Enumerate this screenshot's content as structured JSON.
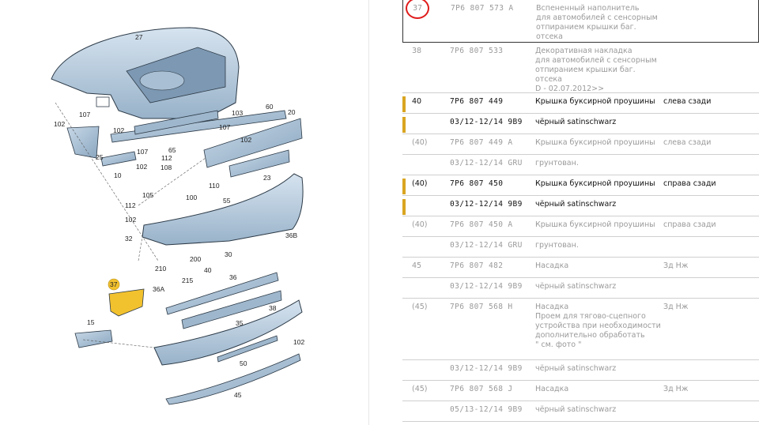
{
  "diagram": {
    "callouts": [
      "27",
      "107",
      "102",
      "25",
      "102",
      "107",
      "112",
      "108",
      "102",
      "10",
      "105",
      "100",
      "112",
      "102",
      "32",
      "103",
      "107",
      "102",
      "65",
      "60",
      "20",
      "110",
      "23",
      "55",
      "36B",
      "30",
      "200",
      "210",
      "40",
      "215",
      "36",
      "36A",
      "38",
      "37",
      "15",
      "35",
      "102",
      "50",
      "45"
    ]
  },
  "parts_table": {
    "rows": [
      {
        "pos": "37",
        "num": "7P6 807 573 A",
        "desc": "Вспененный наполнитель\nдля автомобилей с сенсорным\nотпиранием крышки баг. отсека",
        "side": "",
        "style": "dim",
        "circled": true,
        "marker": false,
        "height": 54
      },
      {
        "pos": "38",
        "num": "7P6 807 533",
        "desc": "Декоративная накладка\nдля автомобилей с сенсорным\nотпиранием крышки баг. отсека\nD - 02.07.2012>>",
        "side": "",
        "style": "dim",
        "circled": false,
        "marker": false,
        "height": 64
      },
      {
        "pos": "40",
        "num": "7P6 807 449",
        "desc": "Крышка буксирной проушины",
        "side": "слева сзади",
        "style": "bold",
        "circled": false,
        "marker": true,
        "height": 26
      },
      {
        "pos": "",
        "num": "03/12-12/14 9B9",
        "desc": "чёрный satinschwarz",
        "side": "",
        "style": "bold",
        "circled": false,
        "marker": true,
        "height": 26
      },
      {
        "pos": "(40)",
        "num": "7P6 807 449 A",
        "desc": "Крышка буксирной проушины",
        "side": "слева сзади",
        "style": "dim",
        "circled": false,
        "marker": false,
        "height": 26
      },
      {
        "pos": "",
        "num": "03/12-12/14 GRU",
        "desc": "грунтован.",
        "side": "",
        "style": "dim",
        "circled": false,
        "marker": false,
        "height": 26
      },
      {
        "pos": "(40)",
        "num": "7P6 807 450",
        "desc": "Крышка буксирной проушины",
        "side": "справа сзади",
        "style": "bold",
        "circled": false,
        "marker": true,
        "height": 26
      },
      {
        "pos": "",
        "num": "03/12-12/14 9B9",
        "desc": "чёрный satinschwarz",
        "side": "",
        "style": "bold",
        "circled": false,
        "marker": true,
        "height": 26
      },
      {
        "pos": "(40)",
        "num": "7P6 807 450 A",
        "desc": "Крышка буксирной проушины",
        "side": "справа сзади",
        "style": "dim",
        "circled": false,
        "marker": false,
        "height": 26
      },
      {
        "pos": "",
        "num": "03/12-12/14 GRU",
        "desc": "грунтован.",
        "side": "",
        "style": "dim",
        "circled": false,
        "marker": false,
        "height": 26
      },
      {
        "pos": "45",
        "num": "7P6 807 482",
        "desc": "Насадка",
        "side": "Зд Нж",
        "style": "dim",
        "circled": false,
        "marker": false,
        "height": 26
      },
      {
        "pos": "",
        "num": "03/12-12/14 9B9",
        "desc": "чёрный satinschwarz",
        "side": "",
        "style": "dim",
        "circled": false,
        "marker": false,
        "height": 26
      },
      {
        "pos": "(45)",
        "num": "7P6 807 568 H",
        "desc": "Насадка\nПроем для тягово-сцепного\nустройства при необходимости\nдополнительно обработать\n\" см. фото \"",
        "side": "Зд Нж",
        "style": "dim",
        "circled": false,
        "marker": false,
        "height": 78
      },
      {
        "pos": "",
        "num": "03/12-12/14 9B9",
        "desc": "чёрный satinschwarz",
        "side": "",
        "style": "dim",
        "circled": false,
        "marker": false,
        "height": 26
      },
      {
        "pos": "(45)",
        "num": "7P6 807 568 J",
        "desc": "Насадка",
        "side": "Зд Нж",
        "style": "dim",
        "circled": false,
        "marker": false,
        "height": 26
      },
      {
        "pos": "",
        "num": "05/13-12/14 9B9",
        "desc": "чёрный satinschwarz",
        "side": "",
        "style": "dim",
        "circled": false,
        "marker": false,
        "height": 26
      }
    ]
  },
  "colors": {
    "accent_marker": "#d9a521",
    "highlight_circle": "#e01b1b",
    "part_fill": "#b9cde0",
    "part_stroke": "#2d3b48",
    "callout_badge": "#f2c12e"
  }
}
